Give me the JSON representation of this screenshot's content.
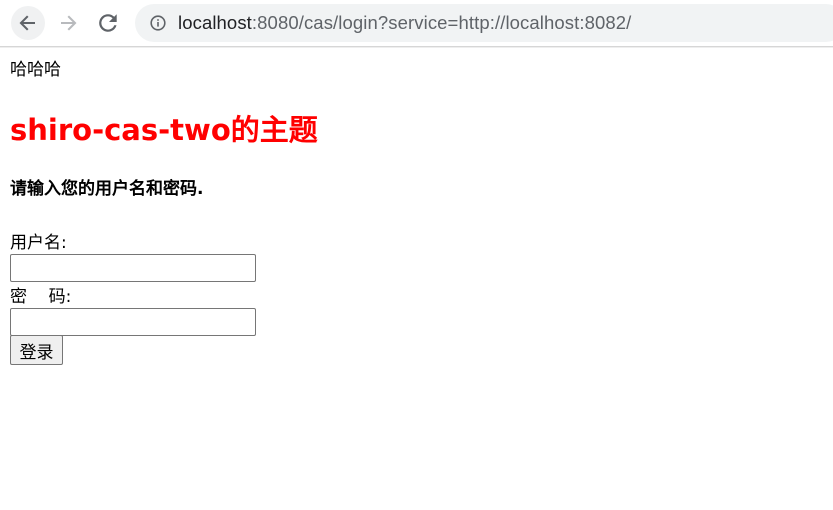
{
  "browser": {
    "url_host": "localhost",
    "url_rest": ":8080/cas/login?service=http://localhost:8082/"
  },
  "page": {
    "top_text": "哈哈哈",
    "title": "shiro-cas-two的主题",
    "instruction": "请输入您的用户名和密码.",
    "username_label": "用户名:",
    "username_value": "",
    "password_label": "密    码:",
    "password_value": "",
    "submit_label": "登录"
  },
  "colors": {
    "title": "#ff0000"
  }
}
